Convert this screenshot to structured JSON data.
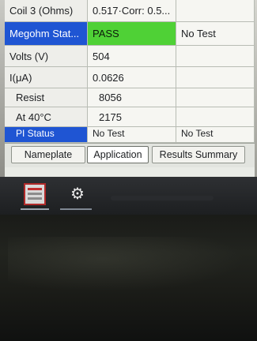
{
  "table": {
    "rows": [
      {
        "label": "Coil 3 (Ohms)",
        "value": "0.517·Corr: 0.5...",
        "extra": ""
      },
      {
        "label": "Megohm Stat...",
        "value": "PASS",
        "extra": "No Test"
      },
      {
        "label": "Volts (V)",
        "value": "504",
        "extra": ""
      },
      {
        "label": "I(μA)",
        "value": "0.0626",
        "extra": ""
      },
      {
        "label": "Resist",
        "value": "8056",
        "extra": ""
      },
      {
        "label": "At 40°C",
        "value": "2175",
        "extra": ""
      },
      {
        "label": "PI Status",
        "value": "No Test",
        "extra": "No Test"
      }
    ]
  },
  "tabs": [
    {
      "label": "Nameplate"
    },
    {
      "label": "Application"
    },
    {
      "label": "Results Summary"
    }
  ],
  "colors": {
    "selected_header": "#1f55d3",
    "pass_green": "#4fd136"
  },
  "taskbar": {
    "icons": [
      "report-app-icon",
      "gear-app-icon"
    ]
  }
}
